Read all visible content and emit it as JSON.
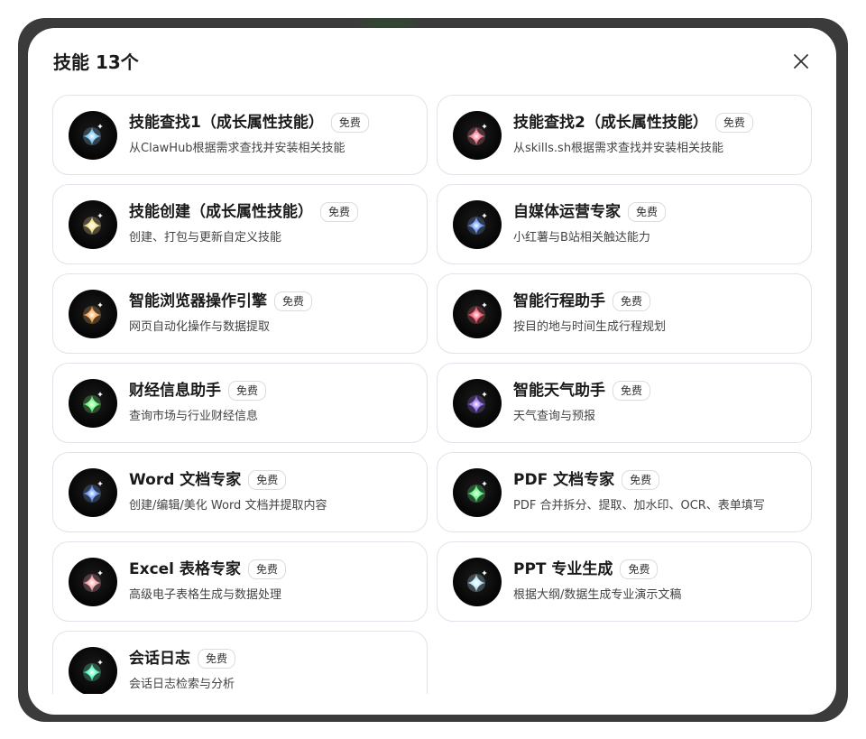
{
  "modal": {
    "title": "技能 13个",
    "close_icon": "close-icon"
  },
  "skills": [
    {
      "name": "技能查找1（成长属性技能）",
      "badge": "免费",
      "desc": "从ClawHub根据需求查找并安装相关技能",
      "color": "#8fd3ff"
    },
    {
      "name": "技能查找2（成长属性技能）",
      "badge": "免费",
      "desc": "从skills.sh根据需求查找并安装相关技能",
      "color": "#ff8aa0"
    },
    {
      "name": "技能创建（成长属性技能）",
      "badge": "免费",
      "desc": "创建、打包与更新自定义技能",
      "color": "#ffe9a0"
    },
    {
      "name": "自媒体运营专家",
      "badge": "免费",
      "desc": "小红薯与B站相关触达能力",
      "color": "#7aa6ff"
    },
    {
      "name": "智能浏览器操作引擎",
      "badge": "免费",
      "desc": "网页自动化操作与数据提取",
      "color": "#ffb86b"
    },
    {
      "name": "智能行程助手",
      "badge": "免费",
      "desc": "按目的地与时间生成行程规划",
      "color": "#ff6b7d"
    },
    {
      "name": "财经信息助手",
      "badge": "免费",
      "desc": "查询市场与行业财经信息",
      "color": "#7dff8a"
    },
    {
      "name": "智能天气助手",
      "badge": "免费",
      "desc": "天气查询与预报",
      "color": "#a57dff"
    },
    {
      "name": "Word 文档专家",
      "badge": "免费",
      "desc": "创建/编辑/美化 Word 文档并提取内容",
      "color": "#7aa6ff"
    },
    {
      "name": "PDF 文档专家",
      "badge": "免费",
      "desc": "PDF 合并拆分、提取、加水印、OCR、表单填写",
      "color": "#6bff8a"
    },
    {
      "name": "Excel 表格专家",
      "badge": "免费",
      "desc": "高级电子表格生成与数据处理",
      "color": "#ffb0b8"
    },
    {
      "name": "PPT 专业生成",
      "badge": "免费",
      "desc": "根据大纲/数据生成专业演示文稿",
      "color": "#c8f0ff"
    },
    {
      "name": "会话日志",
      "badge": "免费",
      "desc": "会话日志检索与分析",
      "color": "#6bffc8"
    }
  ]
}
